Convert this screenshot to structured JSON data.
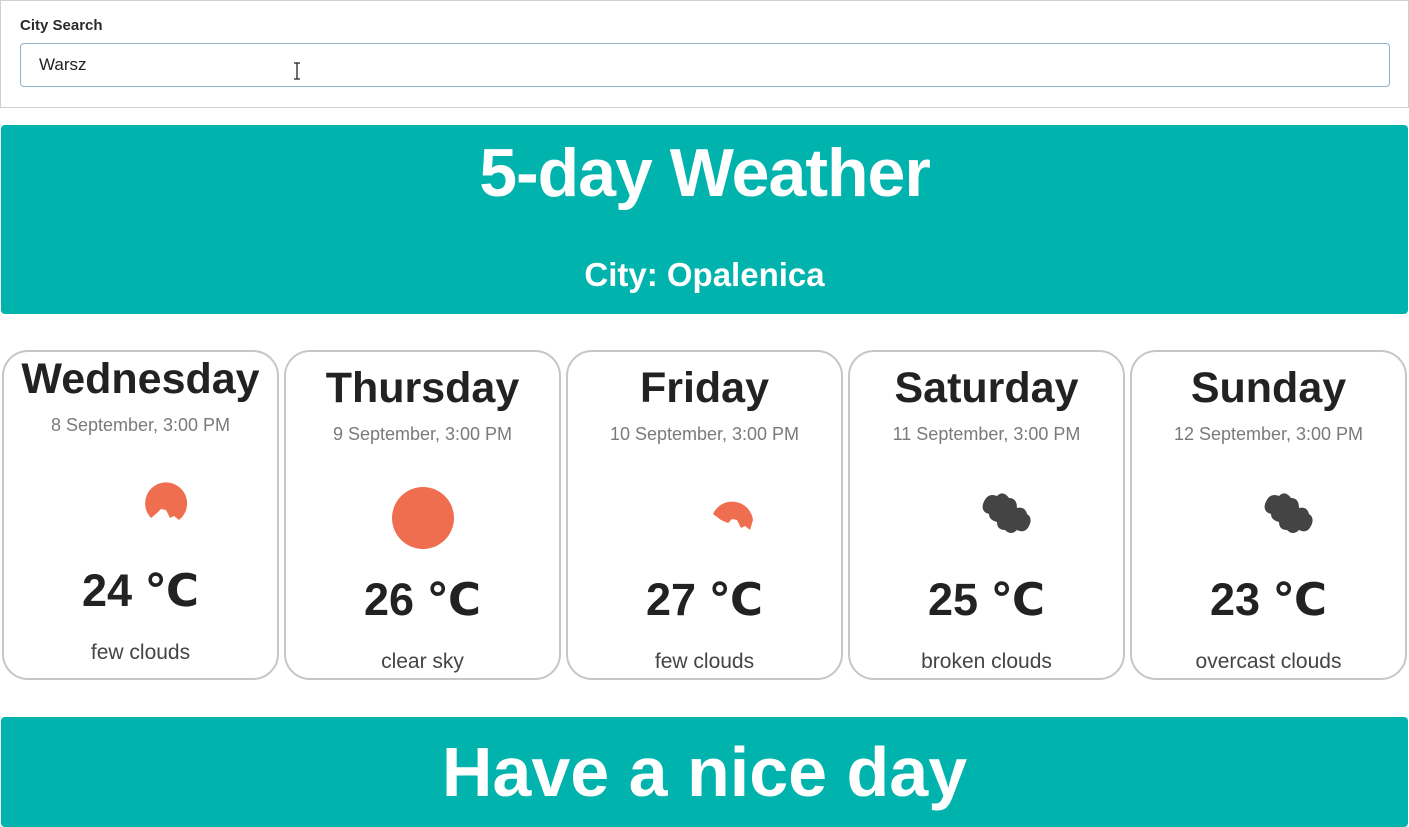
{
  "search": {
    "label": "City Search",
    "value": "Warsz",
    "placeholder": ""
  },
  "header": {
    "title": "5-day Weather",
    "city": "City: Opalenica"
  },
  "colors": {
    "accent": "#00b3ad",
    "sun": "#ee6e4f",
    "cloud": "#444444"
  },
  "forecast": [
    {
      "day": "Wednesday",
      "date": "8 September, 3:00 PM",
      "icon": "few-clouds-icon",
      "temp": "24 ℃",
      "desc": "few clouds"
    },
    {
      "day": "Thursday",
      "date": "9 September, 3:00 PM",
      "icon": "clear-sky-icon",
      "temp": "26 ℃",
      "desc": "clear sky"
    },
    {
      "day": "Friday",
      "date": "10 September, 3:00 PM",
      "icon": "few-clouds-icon",
      "temp": "27 ℃",
      "desc": "few clouds"
    },
    {
      "day": "Saturday",
      "date": "11 September, 3:00 PM",
      "icon": "broken-clouds-icon",
      "temp": "25 ℃",
      "desc": "broken clouds"
    },
    {
      "day": "Sunday",
      "date": "12 September, 3:00 PM",
      "icon": "overcast-clouds-icon",
      "temp": "23 ℃",
      "desc": "overcast clouds"
    }
  ],
  "footer": {
    "text": "Have a nice day"
  }
}
